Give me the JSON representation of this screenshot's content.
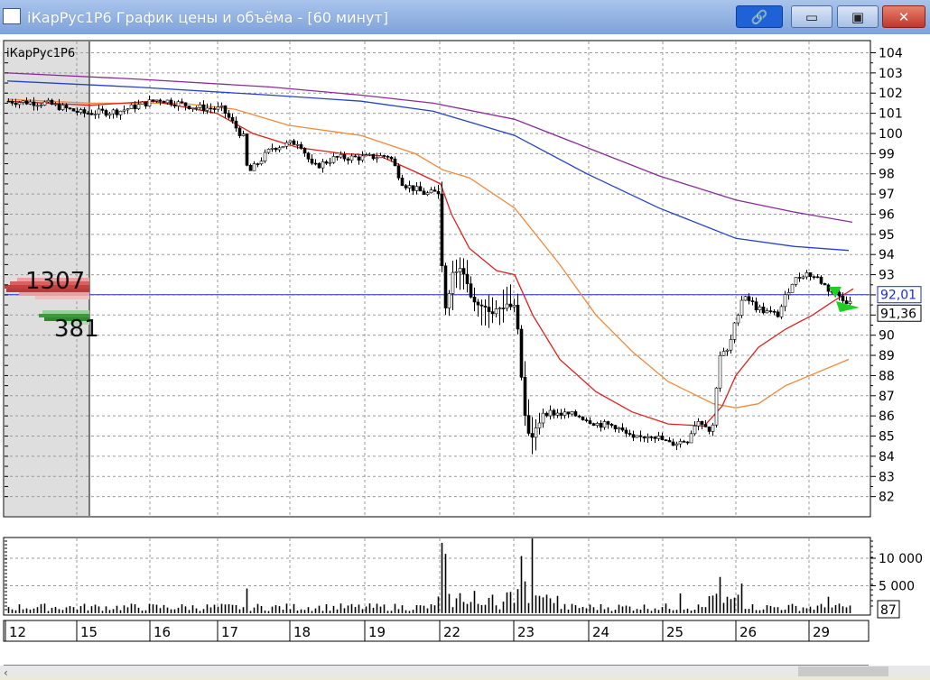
{
  "window": {
    "title": "iКарРус1Р6 График цены и объёма - [60 минут]",
    "min_glyph": "▭",
    "max_glyph": "▣",
    "close_glyph": "✕",
    "link_glyph": "🔗"
  },
  "chart": {
    "instrument": "iКарРус1Р6",
    "price_ticks": [
      "104",
      "103",
      "102",
      "101",
      "100",
      "99",
      "98",
      "97",
      "96",
      "95",
      "94",
      "93",
      "92",
      "91",
      "90",
      "89",
      "88",
      "87",
      "86",
      "85",
      "84",
      "83",
      "82"
    ],
    "price_tick_values": [
      104,
      103,
      102,
      101,
      100,
      99,
      98,
      97,
      96,
      95,
      94,
      93,
      92,
      91,
      90,
      89,
      88,
      87,
      86,
      85,
      84,
      83,
      82
    ],
    "current_price_label": "92,01",
    "current_price": 92.01,
    "ma_price_label": "91,36",
    "ma_price": 91.36,
    "volume_ticks": [
      "10 000",
      "5 000"
    ],
    "volume_tick_values": [
      10000,
      5000
    ],
    "volume_current_label": "87",
    "days": [
      "12",
      "15",
      "16",
      "17",
      "18",
      "19",
      "22",
      "23",
      "24",
      "25",
      "26",
      "29"
    ],
    "sell_volume_label": "1307",
    "buy_volume_label": "381"
  },
  "colors": {
    "price_line": "#1a2fc0",
    "ma_red": "#e0201c",
    "ma_orange": "#f08a3c",
    "ma_blue": "#2742c8",
    "ma_purple": "#8a2c9a",
    "arrow_green": "#1fd01f",
    "grid": "#9a9a9a",
    "shade": "#dcdcdc"
  },
  "chart_data": {
    "type": "line",
    "title": "iКарРус1Р6",
    "x": [
      "12",
      "15",
      "16",
      "17",
      "18",
      "19",
      "22",
      "23",
      "24",
      "25",
      "26",
      "29"
    ],
    "ylim": [
      81.5,
      104.5
    ],
    "series": [
      {
        "values": [
          101.5,
          101.2,
          101.6,
          101.2,
          98.5,
          99.0,
          96.5,
          85.8,
          86.0,
          85.5,
          92.0,
          92.5
        ]
      }
    ],
    "volume": {
      "ylim": [
        0,
        12000
      ],
      "last": 87
    }
  }
}
